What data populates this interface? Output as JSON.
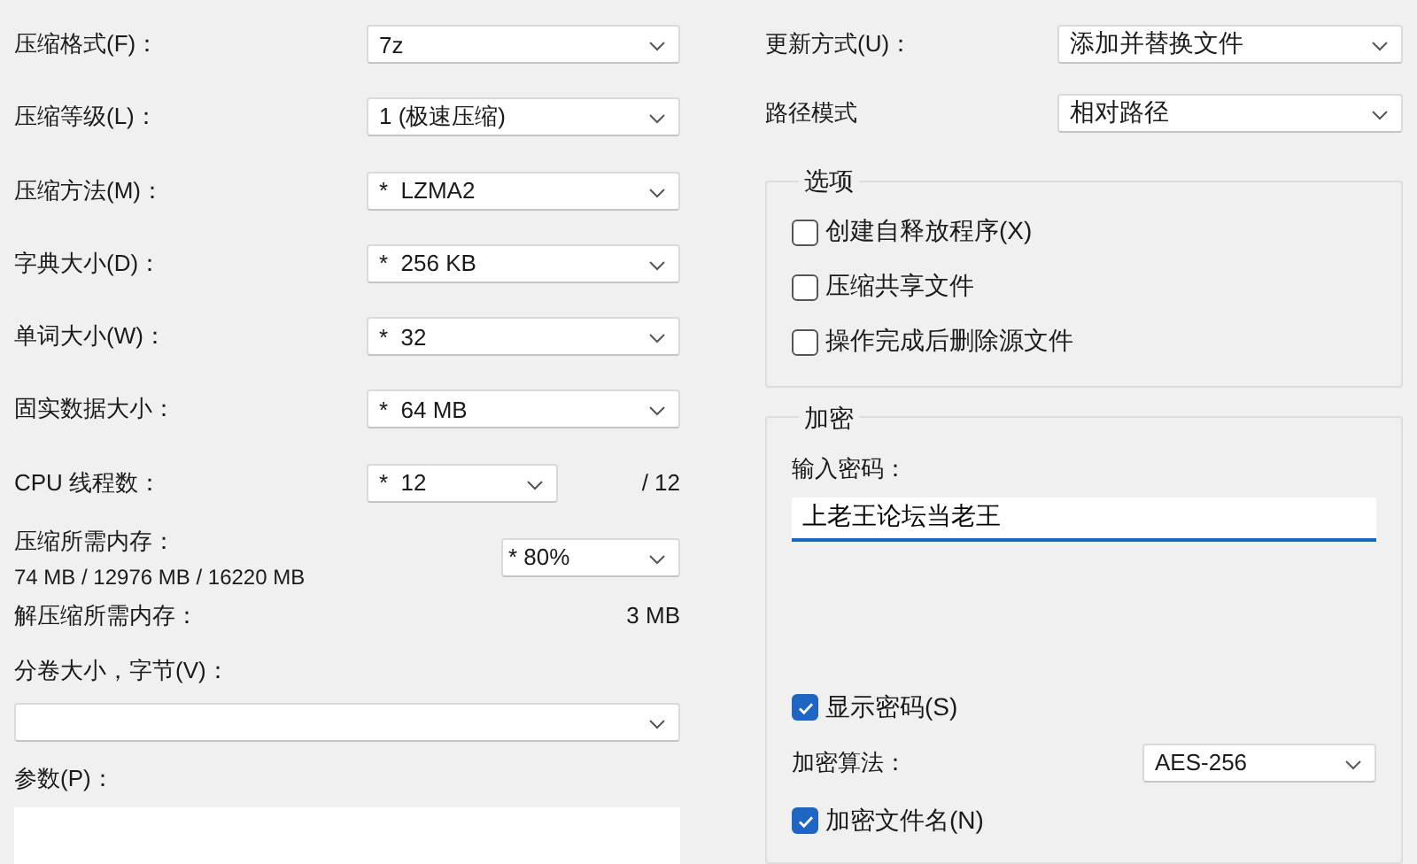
{
  "left_rows": [
    {
      "kind": "combo",
      "label": "压缩格式(F)：",
      "value": "7z"
    },
    {
      "kind": "combo",
      "label": "压缩等级(L)：",
      "value": "1 (极速压缩)"
    },
    {
      "kind": "combo",
      "label": "压缩方法(M)：",
      "value": "*  LZMA2"
    },
    {
      "kind": "combo",
      "label": "字典大小(D)：",
      "value": "*  256 KB"
    },
    {
      "kind": "combo",
      "label": "单词大小(W)：",
      "value": "*  32"
    },
    {
      "kind": "combo",
      "label": "固实数据大小：",
      "value": "*  64 MB"
    },
    {
      "kind": "threads",
      "label": "CPU 线程数：",
      "value": "*  12",
      "suffix": "/ 12"
    },
    {
      "kind": "memory",
      "label": "压缩所需内存：",
      "detail": "74 MB / 12976 MB / 16220 MB",
      "value": "* 80%"
    },
    {
      "kind": "info",
      "label": "解压缩所需内存：",
      "value": "3 MB"
    },
    {
      "kind": "wide_combo",
      "label": "分卷大小，字节(V)："
    },
    {
      "kind": "textarea",
      "label": "参数(P)："
    }
  ],
  "update": {
    "label": "更新方式(U)：",
    "value": "添加并替换文件"
  },
  "path_mode": {
    "label": "路径模式",
    "value": "相对路径"
  },
  "options": {
    "title": "选项",
    "items": [
      {
        "label": "创建自释放程序(X)",
        "checked": false
      },
      {
        "label": "压缩共享文件",
        "checked": false
      },
      {
        "label": "操作完成后删除源文件",
        "checked": false
      }
    ]
  },
  "encryption": {
    "title": "加密",
    "password_label": "输入密码：",
    "password_value": "上老王论坛当老王",
    "show_password": {
      "label": "显示密码(S)",
      "checked": true
    },
    "method": {
      "label": "加密算法：",
      "value": "AES-256"
    },
    "encrypt_names": {
      "label": "加密文件名(N)",
      "checked": true
    }
  }
}
